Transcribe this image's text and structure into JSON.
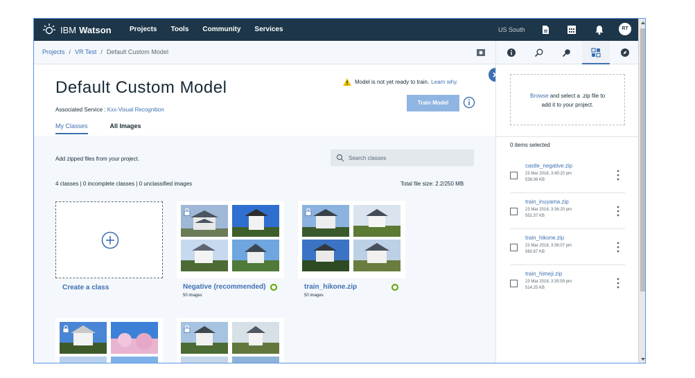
{
  "topnav": {
    "brand_prefix": "IBM",
    "brand_name": "Watson",
    "links": [
      "Projects",
      "Tools",
      "Community",
      "Services"
    ],
    "region": "US South",
    "avatar_initials": "RT"
  },
  "breadcrumb": {
    "items": [
      "Projects",
      "VR Test",
      "Default Custom Model"
    ],
    "separator": "/"
  },
  "header": {
    "title": "Default Custom Model",
    "assoc_label": "Associated Service : ",
    "assoc_service": "Kxx-Visual Recognition",
    "tabs": [
      "My Classes",
      "All Images"
    ],
    "warning_text": "Model is not yet ready to train.",
    "warning_link": "Learn why.",
    "train_button": "Train Model"
  },
  "content": {
    "add_note": "Add zipped files from your project.",
    "search_placeholder": "Search classes",
    "stats": "4 classes | 0 incomplete classes | 0 unclassified images",
    "file_size": "Total file size: 2.2/250 MB",
    "create_label": "Create a class",
    "classes": [
      {
        "name": "Negative (recommended)",
        "count": "50 images"
      },
      {
        "name": "train_hikone.zip",
        "count": "50 images"
      }
    ]
  },
  "rpanel": {
    "dropzone_link": "Browse",
    "dropzone_text1": " and select a .zip file to",
    "dropzone_text2": "add it to your project.",
    "selected": "0 items selected",
    "files": [
      {
        "name": "castle_negative.zip",
        "date": "23 Mar 2018, 3:45:20 pm",
        "size": "538.06 KB"
      },
      {
        "name": "train_inuyama.zip",
        "date": "23 Mar 2018, 3:36:20 pm",
        "size": "552.37 KB"
      },
      {
        "name": "train_hikone.zip",
        "date": "23 Mar 2018, 3:36:07 pm",
        "size": "560.87 KB"
      },
      {
        "name": "train_himeji.zip",
        "date": "23 Mar 2018, 3:35:59 pm",
        "size": "514.25 KB"
      }
    ]
  },
  "colors": {
    "nav_bg": "#1d3649",
    "accent": "#3d70b2",
    "train_disabled": "#8fb5e2",
    "success": "#5aa700",
    "warning": "#efc100"
  }
}
